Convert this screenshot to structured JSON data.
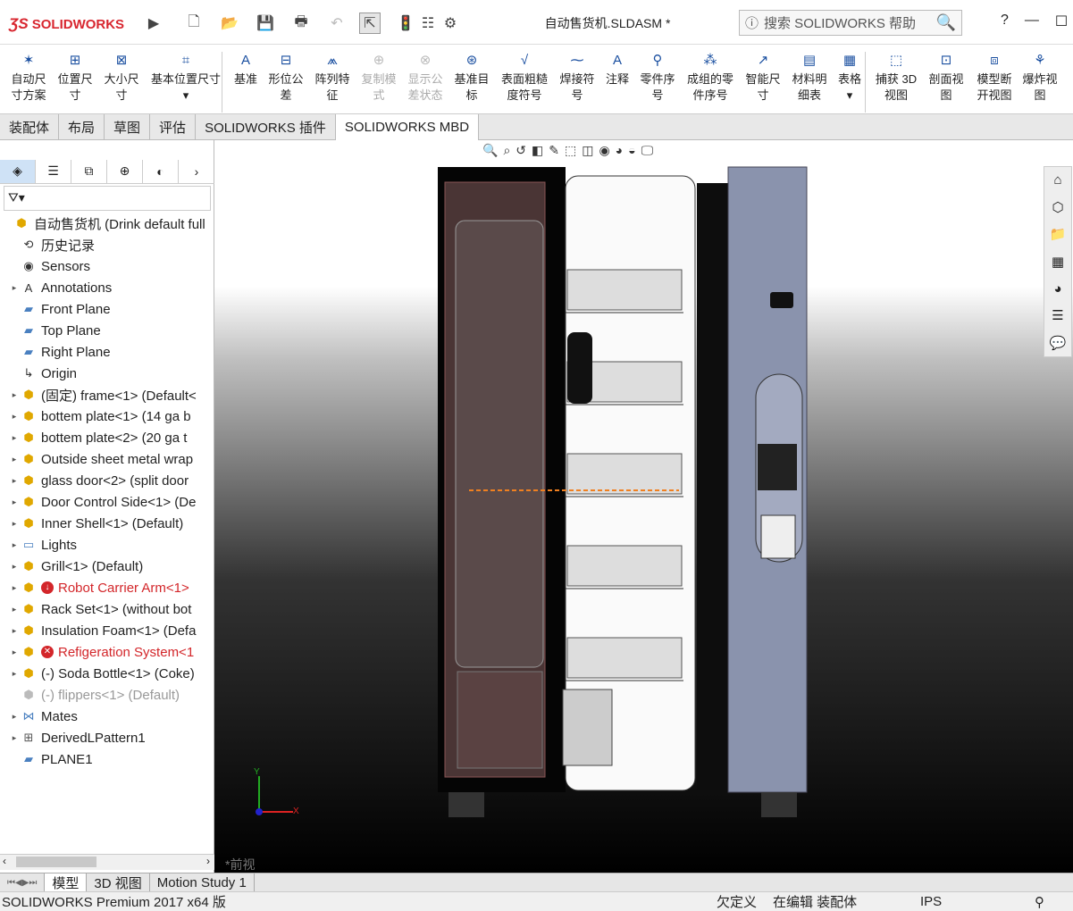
{
  "app": {
    "brand": "SOLIDWORKS",
    "document_title": "自动售货机.SLDASM *"
  },
  "search": {
    "placeholder": "搜索 SOLIDWORKS 帮助"
  },
  "window": {
    "help": "?",
    "minimize": "—",
    "maximize": "☐",
    "close": "✕"
  },
  "ribbon": [
    {
      "label1": "自动尺",
      "label2": "寸方案",
      "icon": "auto-dimension-icon",
      "disabled": false
    },
    {
      "label1": "位置尺",
      "label2": "寸",
      "icon": "location-dimension-icon",
      "disabled": false
    },
    {
      "label1": "大小尺",
      "label2": "寸",
      "icon": "size-dimension-icon",
      "disabled": false
    },
    {
      "label1": "基本位置尺寸",
      "label2": "▾",
      "icon": "basic-location-icon",
      "disabled": false
    },
    {
      "label1": "基准",
      "label2": "",
      "icon": "datum-icon",
      "disabled": false
    },
    {
      "label1": "形位公",
      "label2": "差",
      "icon": "geometric-tolerance-icon",
      "disabled": false
    },
    {
      "label1": "阵列特",
      "label2": "征",
      "icon": "pattern-feature-icon",
      "disabled": false
    },
    {
      "label1": "复制模",
      "label2": "式",
      "icon": "copy-scheme-icon",
      "disabled": true
    },
    {
      "label1": "显示公",
      "label2": "差状态",
      "icon": "show-tolerance-icon",
      "disabled": true
    },
    {
      "label1": "基准目",
      "label2": "标",
      "icon": "datum-target-icon",
      "disabled": false
    },
    {
      "label1": "表面粗糙",
      "label2": "度符号",
      "icon": "surface-finish-icon",
      "disabled": false
    },
    {
      "label1": "焊接符",
      "label2": "号",
      "icon": "weld-symbol-icon",
      "disabled": false
    },
    {
      "label1": "注释",
      "label2": "",
      "icon": "note-icon",
      "disabled": false
    },
    {
      "label1": "零件序",
      "label2": "号",
      "icon": "balloon-icon",
      "disabled": false
    },
    {
      "label1": "成组的零",
      "label2": "件序号",
      "icon": "stacked-balloon-icon",
      "disabled": false
    },
    {
      "label1": "智能尺",
      "label2": "寸",
      "icon": "smart-dimension-icon",
      "disabled": false
    },
    {
      "label1": "材料明",
      "label2": "细表",
      "icon": "bom-icon",
      "disabled": false
    },
    {
      "label1": "表格",
      "label2": "▾",
      "icon": "table-icon",
      "disabled": false
    },
    {
      "label1": "捕获 3D",
      "label2": "视图",
      "icon": "capture-3d-view-icon",
      "disabled": false
    },
    {
      "label1": "剖面视",
      "label2": "图",
      "icon": "section-view-icon",
      "disabled": false
    },
    {
      "label1": "模型断",
      "label2": "开视图",
      "icon": "model-break-view-icon",
      "disabled": false
    },
    {
      "label1": "爆炸视",
      "label2": "图",
      "icon": "exploded-view-icon",
      "disabled": false
    }
  ],
  "command_tabs": [
    "装配体",
    "布局",
    "草图",
    "评估",
    "SOLIDWORKS 插件",
    "SOLIDWORKS MBD"
  ],
  "active_command_tab": "SOLIDWORKS MBD",
  "tree": [
    {
      "label": "自动售货机  (Drink default full",
      "icon": "assembly-icon",
      "expand": "",
      "indent": 0,
      "state": "normal"
    },
    {
      "label": "历史记录",
      "icon": "history-icon",
      "expand": "",
      "indent": 1,
      "state": "normal"
    },
    {
      "label": "Sensors",
      "icon": "sensors-icon",
      "expand": "",
      "indent": 1,
      "state": "normal"
    },
    {
      "label": "Annotations",
      "icon": "annotations-icon",
      "expand": "▸",
      "indent": 1,
      "state": "normal"
    },
    {
      "label": "Front Plane",
      "icon": "plane-icon",
      "expand": "",
      "indent": 1,
      "state": "normal"
    },
    {
      "label": "Top Plane",
      "icon": "plane-icon",
      "expand": "",
      "indent": 1,
      "state": "normal"
    },
    {
      "label": "Right Plane",
      "icon": "plane-icon",
      "expand": "",
      "indent": 1,
      "state": "normal"
    },
    {
      "label": "Origin",
      "icon": "origin-icon",
      "expand": "",
      "indent": 1,
      "state": "normal"
    },
    {
      "label": "(固定) frame<1> (Default<",
      "icon": "part-icon",
      "expand": "▸",
      "indent": 1,
      "state": "normal"
    },
    {
      "label": "bottem plate<1> (14 ga b",
      "icon": "part-icon",
      "expand": "▸",
      "indent": 1,
      "state": "normal"
    },
    {
      "label": "bottem plate<2> (20 ga t",
      "icon": "part-icon",
      "expand": "▸",
      "indent": 1,
      "state": "normal"
    },
    {
      "label": "Outside sheet metal wrap",
      "icon": "part-icon",
      "expand": "▸",
      "indent": 1,
      "state": "normal"
    },
    {
      "label": "glass door<2> (split door",
      "icon": "part-icon",
      "expand": "▸",
      "indent": 1,
      "state": "normal"
    },
    {
      "label": "Door Control Side<1> (De",
      "icon": "part-icon",
      "expand": "▸",
      "indent": 1,
      "state": "normal"
    },
    {
      "label": "Inner Shell<1> (Default)",
      "icon": "part-icon",
      "expand": "▸",
      "indent": 1,
      "state": "normal"
    },
    {
      "label": "Lights",
      "icon": "folder-icon",
      "expand": "▸",
      "indent": 1,
      "state": "normal"
    },
    {
      "label": "Grill<1> (Default)",
      "icon": "part-icon",
      "expand": "▸",
      "indent": 1,
      "state": "normal"
    },
    {
      "label": "Robot Carrier Arm<1>",
      "icon": "subassembly-icon",
      "expand": "▸",
      "indent": 1,
      "state": "error"
    },
    {
      "label": "Rack Set<1> (without bot",
      "icon": "part-icon",
      "expand": "▸",
      "indent": 1,
      "state": "normal"
    },
    {
      "label": "Insulation Foam<1> (Defa",
      "icon": "part-icon",
      "expand": "▸",
      "indent": 1,
      "state": "normal"
    },
    {
      "label": "Refigeration System<1",
      "icon": "part-icon",
      "expand": "▸",
      "indent": 1,
      "state": "error2"
    },
    {
      "label": "(-) Soda Bottle<1> (Coke)",
      "icon": "part-icon",
      "expand": "▸",
      "indent": 1,
      "state": "normal"
    },
    {
      "label": "(-) flippers<1> (Default)",
      "icon": "part-suppressed-icon",
      "expand": "",
      "indent": 1,
      "state": "suppressed"
    },
    {
      "label": "Mates",
      "icon": "mates-icon",
      "expand": "▸",
      "indent": 1,
      "state": "normal"
    },
    {
      "label": "DerivedLPattern1",
      "icon": "pattern-icon",
      "expand": "▸",
      "indent": 1,
      "state": "normal"
    },
    {
      "label": "PLANE1",
      "icon": "plane-icon",
      "expand": "",
      "indent": 1,
      "state": "normal"
    }
  ],
  "view_label": "*前视",
  "axis": {
    "x": "X",
    "y": "Y"
  },
  "bottom_tabs": [
    "模型",
    "3D 视图",
    "Motion Study 1"
  ],
  "status": {
    "product": "SOLIDWORKS Premium 2017 x64 版",
    "constraint": "欠定义",
    "mode": "在编辑 装配体",
    "units": "IPS"
  }
}
